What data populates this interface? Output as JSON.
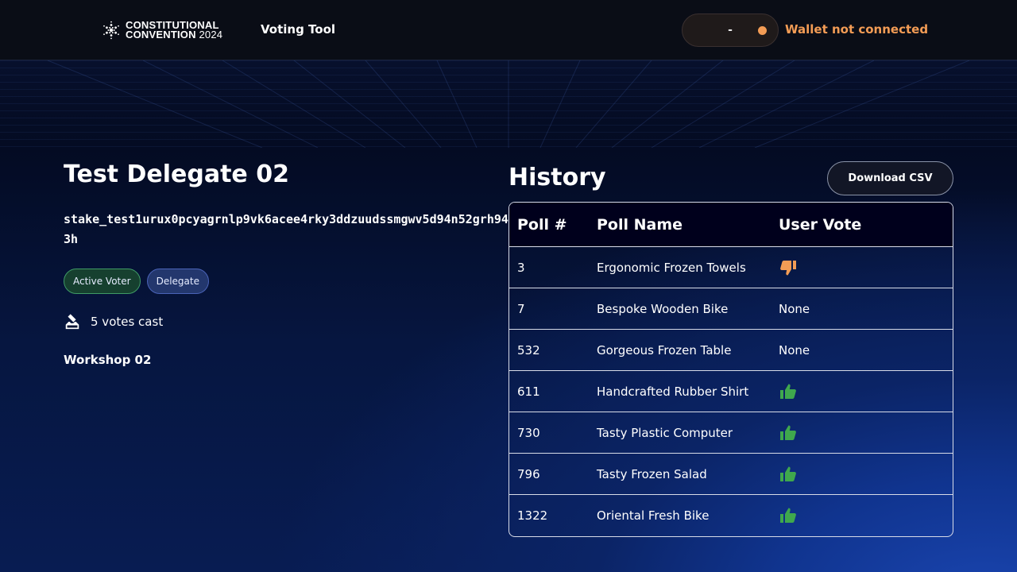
{
  "header": {
    "logo_line1": "CONSTITUTIONAL",
    "logo_line2": "CONVENTION",
    "logo_year": "2024",
    "nav_title": "Voting Tool",
    "wallet_balance": "-",
    "wallet_status": "Wallet not connected",
    "wallet_status_color": "#f39c55"
  },
  "profile": {
    "name": "Test Delegate 02",
    "stake_address": "stake_test1urux0pcyagrnlp9vk6acee4rky3ddzuudssmgwv5d94n52grh943h",
    "badges": [
      "Active Voter",
      "Delegate"
    ],
    "votes_cast": "5 votes cast",
    "workshop": "Workshop 02"
  },
  "history": {
    "title": "History",
    "download_label": "Download CSV",
    "columns": [
      "Poll #",
      "Poll Name",
      "User Vote"
    ],
    "rows": [
      {
        "poll": "3",
        "name": "Ergonomic Frozen Towels",
        "vote": "thumbs-down"
      },
      {
        "poll": "7",
        "name": "Bespoke Wooden Bike",
        "vote": "None"
      },
      {
        "poll": "532",
        "name": "Gorgeous Frozen Table",
        "vote": "None"
      },
      {
        "poll": "611",
        "name": "Handcrafted Rubber Shirt",
        "vote": "thumbs-up"
      },
      {
        "poll": "730",
        "name": "Tasty Plastic Computer",
        "vote": "thumbs-up"
      },
      {
        "poll": "796",
        "name": "Tasty Frozen Salad",
        "vote": "thumbs-up"
      },
      {
        "poll": "1322",
        "name": "Oriental Fresh Bike",
        "vote": "thumbs-up"
      }
    ],
    "colors": {
      "thumbs_up": "#3fa84d",
      "thumbs_down": "#f39c55"
    }
  }
}
